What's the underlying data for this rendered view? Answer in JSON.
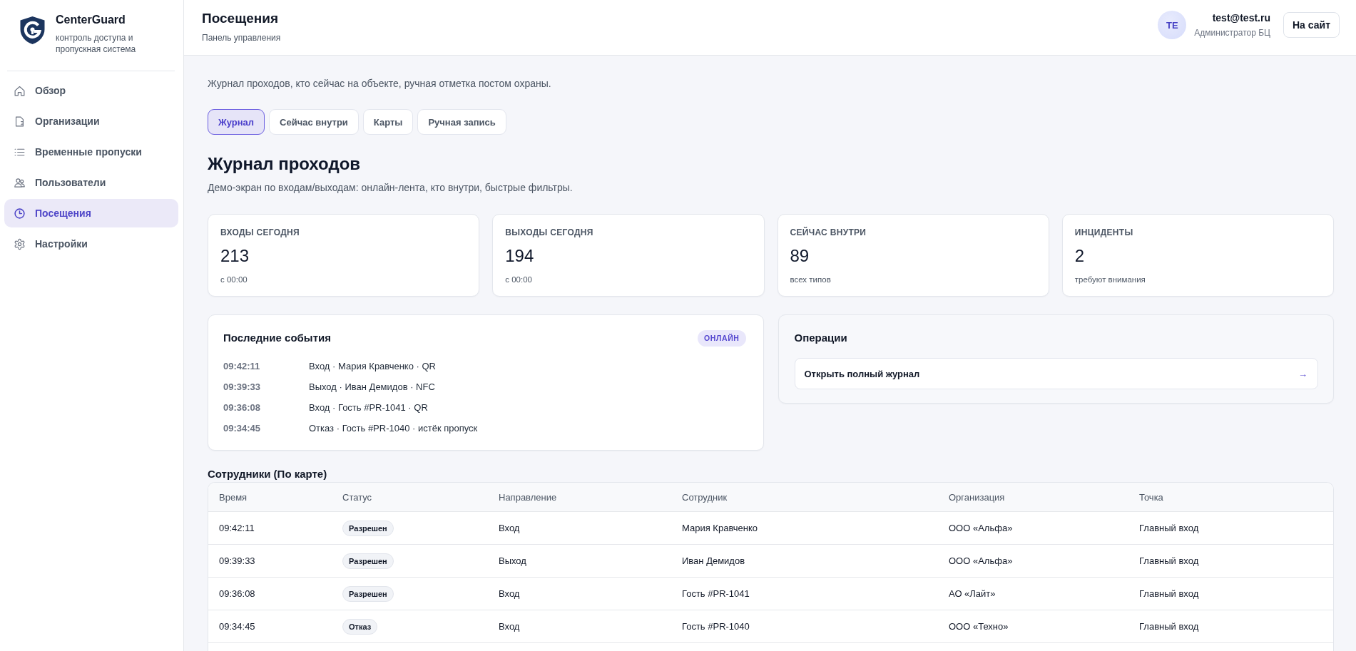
{
  "sidebar": {
    "brand": {
      "name": "CenterGuard",
      "tagline": "контроль доступа и пропускная система"
    },
    "items": [
      {
        "label": "Обзор",
        "selected": false
      },
      {
        "label": "Организации",
        "selected": false
      },
      {
        "label": "Временные пропуски",
        "selected": false
      },
      {
        "label": "Пользователи",
        "selected": false
      },
      {
        "label": "Посещения",
        "selected": true
      },
      {
        "label": "Настройки",
        "selected": false
      }
    ]
  },
  "header": {
    "title": "Посещения",
    "subtitle": "Панель управления",
    "user": {
      "initials": "TE",
      "email": "test@test.ru",
      "role": "Администратор БЦ"
    },
    "site_button": "На сайт"
  },
  "intro": "Журнал проходов, кто сейчас на объекте, ручная отметка постом охраны.",
  "tabs": [
    {
      "label": "Журнал",
      "selected": true
    },
    {
      "label": "Сейчас внутри",
      "selected": false
    },
    {
      "label": "Карты",
      "selected": false
    },
    {
      "label": "Ручная запись",
      "selected": false
    }
  ],
  "section": {
    "title": "Журнал проходов",
    "subtitle": "Демо-экран по входам/выходам: онлайн-лента, кто внутри, быстрые фильтры."
  },
  "stats": [
    {
      "label": "ВХОДЫ СЕГОДНЯ",
      "value": "213",
      "note": "с 00:00"
    },
    {
      "label": "ВЫХОДЫ СЕГОДНЯ",
      "value": "194",
      "note": "с 00:00"
    },
    {
      "label": "СЕЙЧАС ВНУТРИ",
      "value": "89",
      "note": "всех типов"
    },
    {
      "label": "ИНЦИДЕНТЫ",
      "value": "2",
      "note": "требуют внимания"
    }
  ],
  "recent_events": {
    "title": "Последние события",
    "badge": "ОНЛАЙН",
    "events": [
      {
        "time": "09:42:11",
        "text": "Вход · Мария Кравченко · QR"
      },
      {
        "time": "09:39:33",
        "text": "Выход · Иван Демидов · NFC"
      },
      {
        "time": "09:36:08",
        "text": "Вход · Гость #PR-1041 · QR"
      },
      {
        "time": "09:34:45",
        "text": "Отказ · Гость #PR-1040 · истёк пропуск"
      }
    ]
  },
  "operations": {
    "title": "Операции",
    "actions": [
      {
        "label": "Открыть полный журнал",
        "arrow": "→"
      }
    ]
  },
  "table": {
    "title": "Сотрудники (По карте)",
    "columns": [
      "Время",
      "Статус",
      "Направление",
      "Сотрудник",
      "Организация",
      "Точка"
    ],
    "rows": [
      {
        "time": "09:42:11",
        "status": "Разрешен",
        "direction": "Вход",
        "employee": "Мария Кравченко",
        "organization": "ООО «Альфа»",
        "point": "Главный вход"
      },
      {
        "time": "09:39:33",
        "status": "Разрешен",
        "direction": "Выход",
        "employee": "Иван Демидов",
        "organization": "ООО «Альфа»",
        "point": "Главный вход"
      },
      {
        "time": "09:36:08",
        "status": "Разрешен",
        "direction": "Вход",
        "employee": "Гость #PR-1041",
        "organization": "АО «Лайт»",
        "point": "Главный вход"
      },
      {
        "time": "09:34:45",
        "status": "Отказ",
        "direction": "Вход",
        "employee": "Гость #PR-1040",
        "organization": "ООО «Техно»",
        "point": "Главный вход"
      }
    ]
  }
}
